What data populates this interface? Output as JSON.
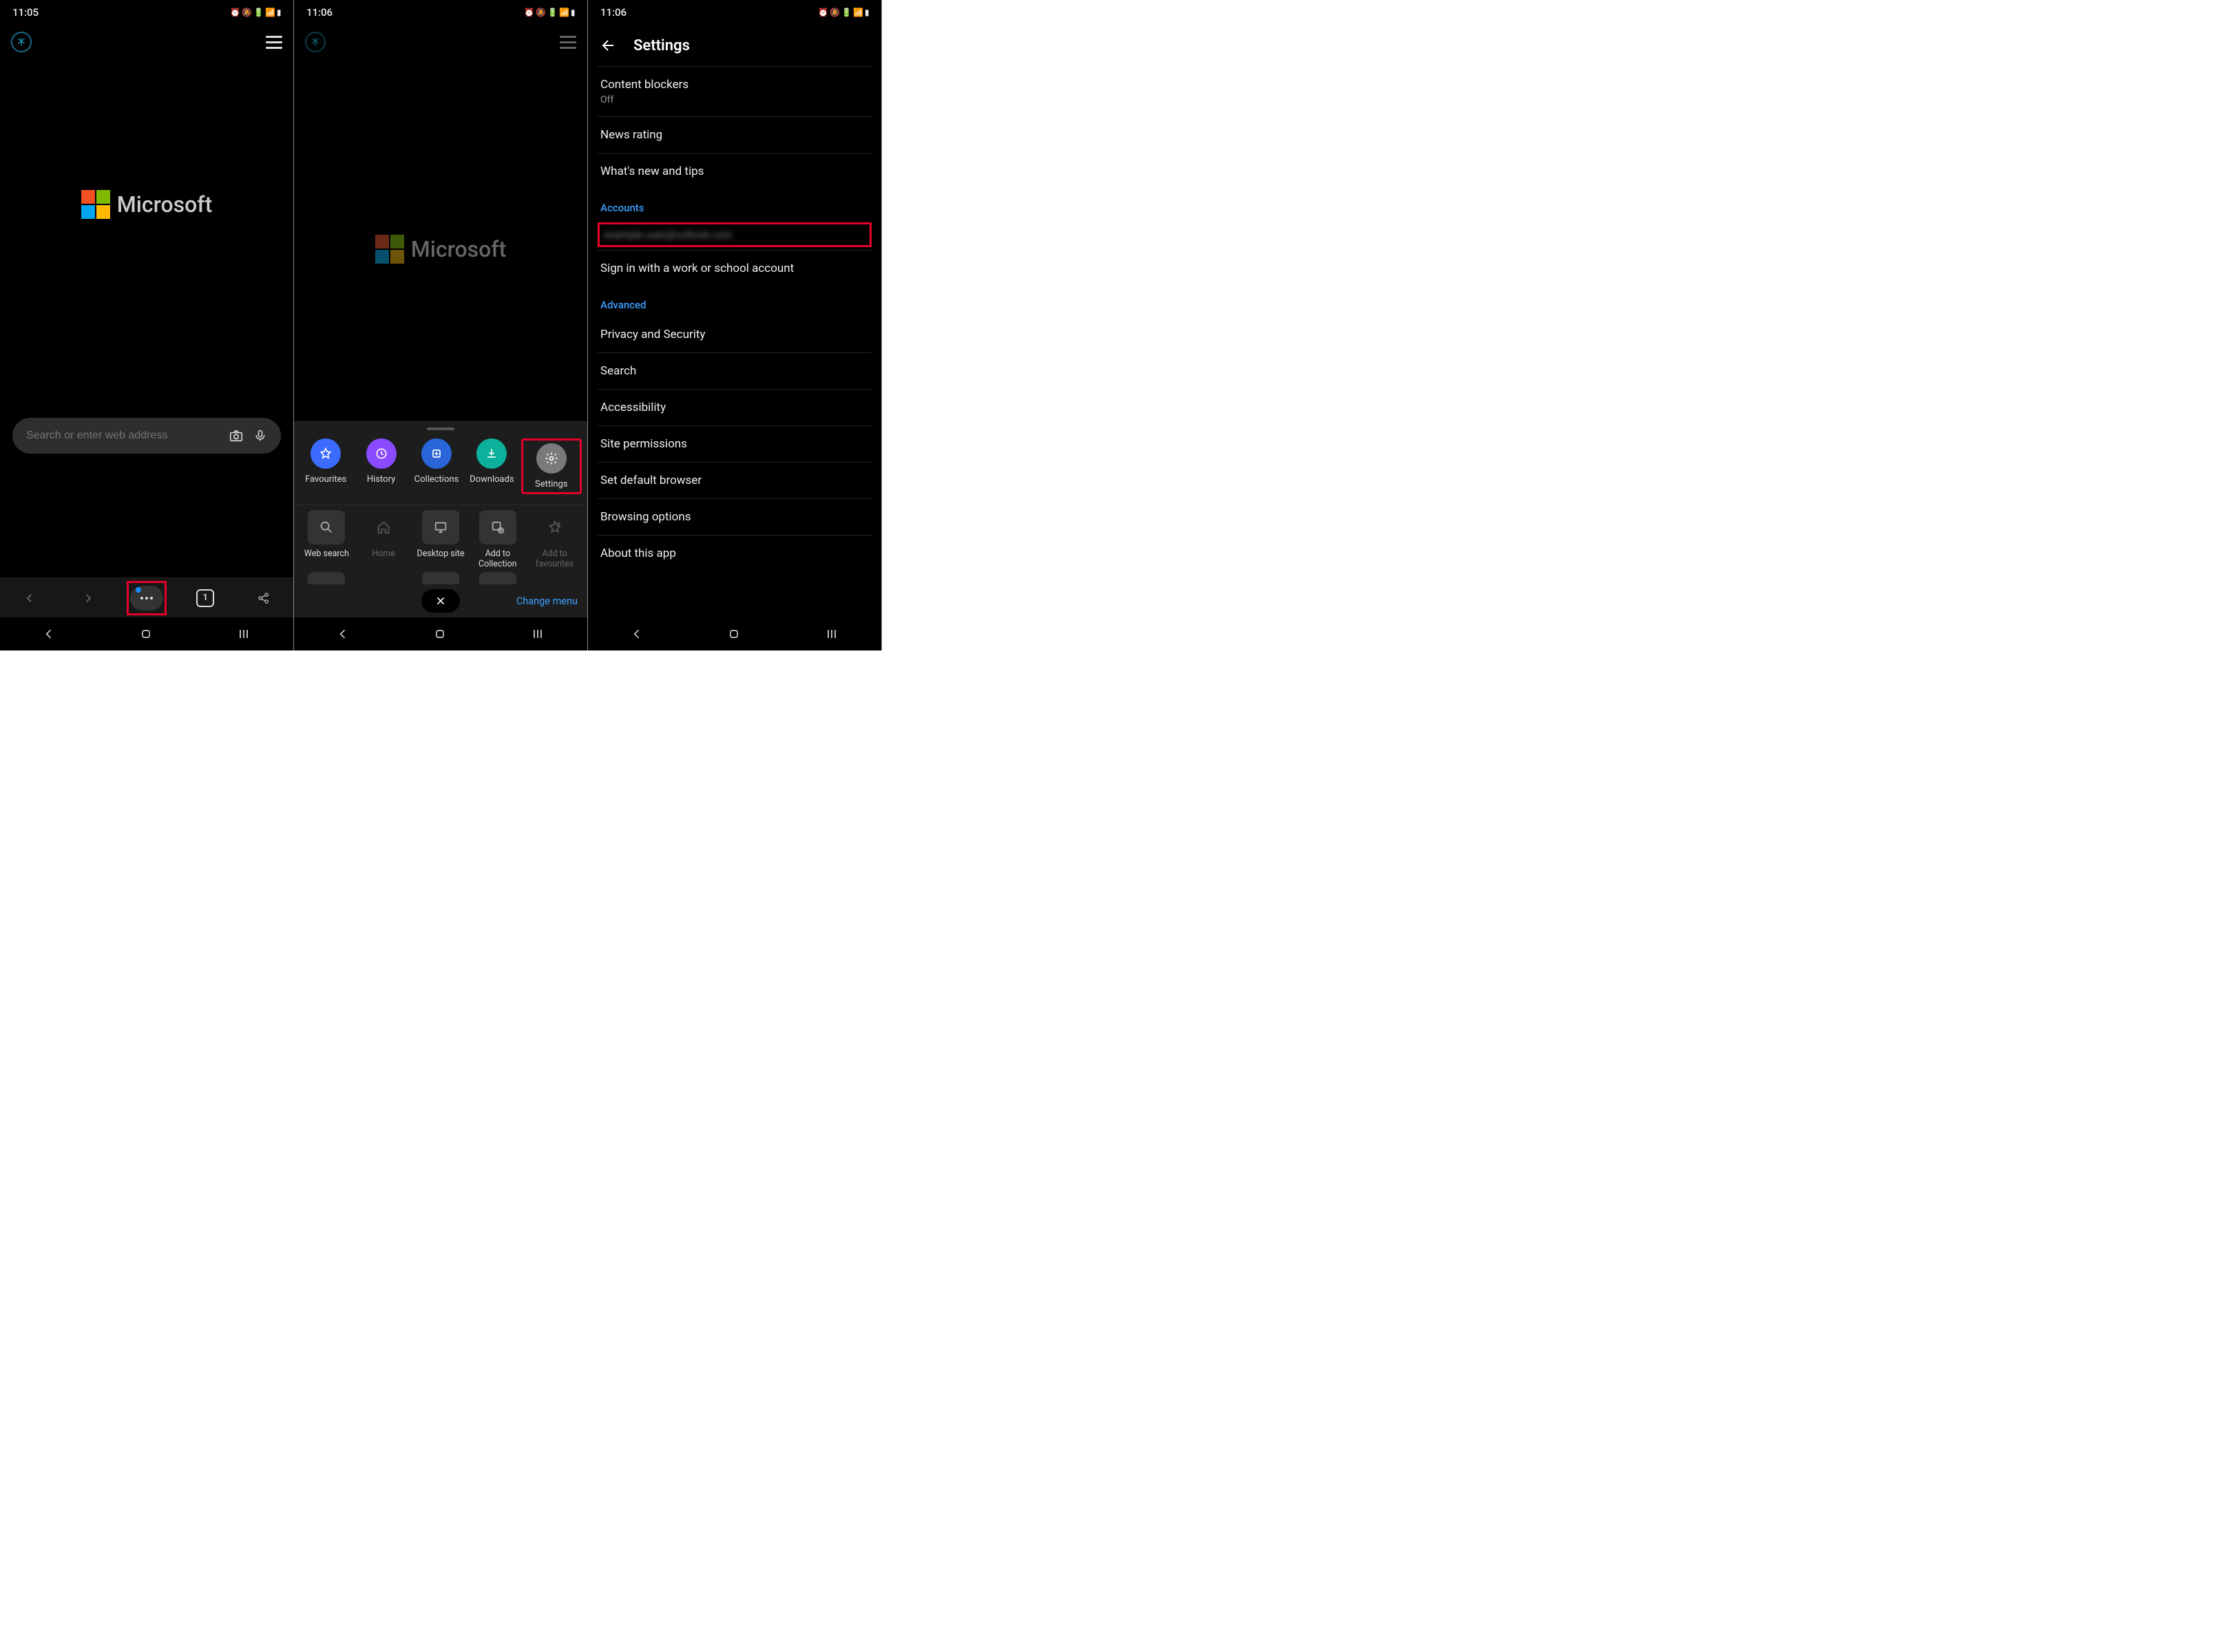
{
  "pane1": {
    "time": "11:05",
    "logo_text": "Microsoft",
    "search_placeholder": "Search or enter web address",
    "tab_count": "1"
  },
  "pane2": {
    "time": "11:06",
    "logo_text": "Microsoft",
    "quick": {
      "fav": "Favourites",
      "hist": "History",
      "coll": "Collections",
      "dl": "Downloads",
      "set": "Settings"
    },
    "grid": {
      "websearch": "Web search",
      "home": "Home",
      "desktop": "Desktop site",
      "addcoll": "Add to Collection",
      "addfav": "Add to favourites"
    },
    "change_menu": "Change menu"
  },
  "pane3": {
    "time": "11:06",
    "title": "Settings",
    "content_blockers": "Content blockers",
    "content_blockers_sub": "Off",
    "news_rating": "News rating",
    "whats_new": "What's new and tips",
    "section_accounts": "Accounts",
    "account_email": "example.user@outlook.com",
    "work_signin": "Sign in with a work or school account",
    "section_advanced": "Advanced",
    "privacy": "Privacy and Security",
    "search": "Search",
    "accessibility": "Accessibility",
    "site_perms": "Site permissions",
    "default_browser": "Set default browser",
    "browsing_opts": "Browsing options",
    "about": "About this app"
  }
}
